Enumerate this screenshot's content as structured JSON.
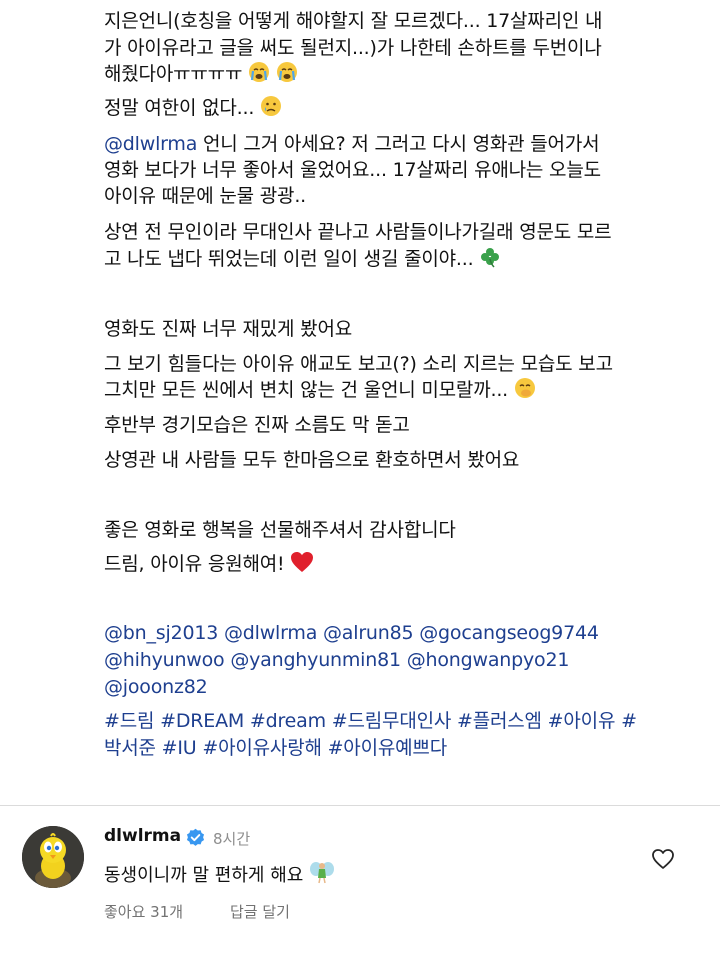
{
  "caption": {
    "paragraph1_line1": "지은언니(호칭을 어떻게 해야할지 잘 모르겠다... 17살짜리인 내",
    "paragraph1_line2": "가 아이유라고 글을 써도 될런지...)가 나한테 손하트를 두번이나",
    "paragraph1_line3": "해줬다아ㅠㅠㅠㅠ",
    "paragraph2": "정말 여한이 없다...",
    "mention_dlwlrma": "@dlwlrma",
    "paragraph3_line1_rest": " 언니 그거 아세요? 저 그러고 다시 영화관 들어가서",
    "paragraph3_line2": "영화 보다가 너무 좋아서 울었어요... 17살짜리 유애나는 오늘도",
    "paragraph3_line3": "아이유 때문에 눈물 광광..",
    "paragraph4_line1": "상연 전 무인이라 무대인사 끝나고 사람들이나가길래 영문도 모르",
    "paragraph4_line2": "고 나도 냅다 뛰었는데 이런 일이 생길 줄이야...",
    "paragraph5": "영화도 진짜 너무 재밌게 봤어요",
    "paragraph6_line1": "그 보기 힘들다는 아이유 애교도 보고(?) 소리 지르는 모습도 보고",
    "paragraph6_line2": "그치만 모든 씬에서 변치 않는 건 울언니 미모랄까...",
    "paragraph7": "후반부 경기모습은 진짜 소름도 막 돋고",
    "paragraph8": "상영관 내 사람들 모두 한마음으로 환호하면서 봤어요",
    "paragraph9": "좋은 영화로 행복을 선물해주셔서 감사합니다",
    "paragraph10": "드림, 아이유 응원해여!",
    "mentions_line1": "@bn_sj2013 @dlwlrma @alrun85 @gocangseog9744",
    "mentions_line2": "@hihyunwoo @yanghyunmin81 @hongwanpyo21",
    "mentions_line3": "@jooonz82",
    "hashtags_line1": "#드림 #DREAM #dream #드림무대인사 #플러스엠 #아이유 #",
    "hashtags_line2": "박서준 #IU #아이유사랑해 #아이유예쁘다"
  },
  "comment": {
    "username": "dlwlrma",
    "time": "8시간",
    "text": "동생이니까 말 편하게 해요",
    "likes": "좋아요 31개",
    "reply": "답글 달기"
  },
  "colors": {
    "link": "#1e3f8f",
    "verified": "#3897f0",
    "muted": "#8e8e8e"
  },
  "icons": [
    "crying-face-icon",
    "sad-tear-face-icon",
    "clover-icon",
    "hand-over-mouth-face-icon",
    "red-heart-icon",
    "verified-badge-icon",
    "fairy-icon",
    "heart-outline-icon"
  ]
}
